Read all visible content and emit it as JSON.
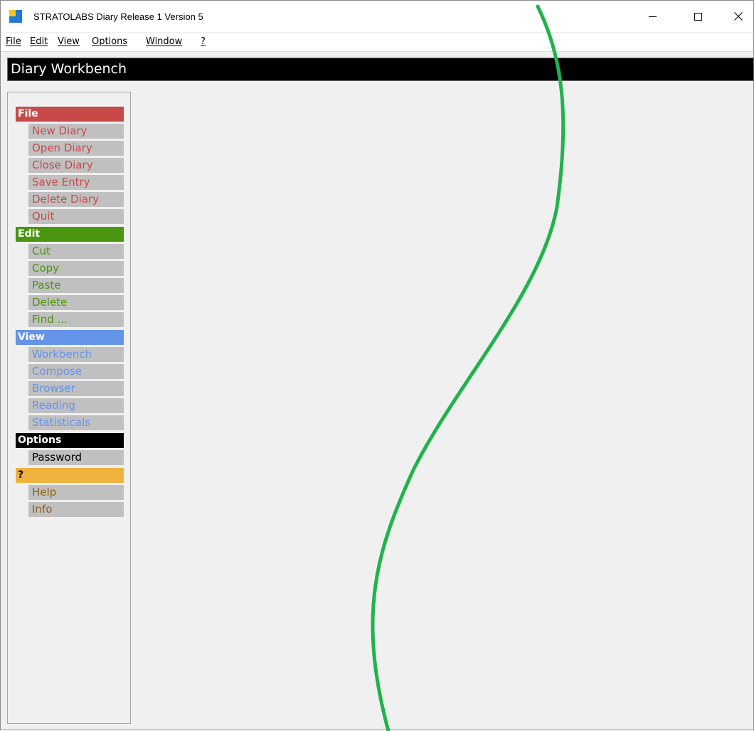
{
  "window": {
    "title": "STRATOLABS Diary Release 1 Version 5"
  },
  "menubar": {
    "items": [
      {
        "label": "File"
      },
      {
        "label": "Edit"
      },
      {
        "label": "View"
      },
      {
        "label": "Options"
      },
      {
        "label": "Window"
      },
      {
        "label": "?"
      }
    ]
  },
  "header": {
    "title": "Diary Workbench"
  },
  "sidebar": {
    "sections": [
      {
        "label": "File",
        "header_bg": "#c84a48",
        "header_fg": "#ffffff",
        "item_fg": "#c84a48",
        "items": [
          "New Diary",
          "Open Diary",
          "Close Diary",
          "Save Entry",
          "Delete Diary",
          "Quit"
        ]
      },
      {
        "label": "Edit",
        "header_bg": "#4a960e",
        "header_fg": "#ffffff",
        "item_fg": "#4a960e",
        "items": [
          "Cut",
          "Copy",
          "Paste",
          "Delete",
          "Find ..."
        ]
      },
      {
        "label": "View",
        "header_bg": "#6493e8",
        "header_fg": "#ffffff",
        "item_fg": "#6493e8",
        "items": [
          "Workbench",
          "Compose",
          "Browser",
          "Reading",
          "Statisticals"
        ]
      },
      {
        "label": "Options",
        "header_bg": "#000000",
        "header_fg": "#ffffff",
        "item_fg": "#000000",
        "items": [
          "Password"
        ]
      },
      {
        "label": "?",
        "header_bg": "#f0b23e",
        "header_fg": "#000000",
        "item_fg": "#8a6418",
        "items": [
          "Help",
          "Info"
        ]
      }
    ]
  },
  "colors": {
    "curve": "#22b24c"
  }
}
